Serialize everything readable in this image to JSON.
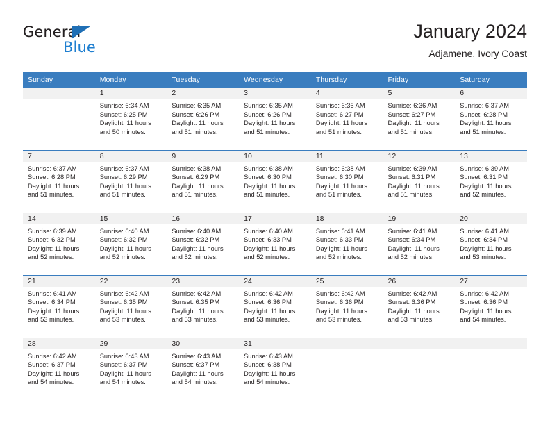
{
  "brand": {
    "name_part1": "General",
    "name_part2": "Blue",
    "triangle_color": "#1f6fb5",
    "blue_color": "#1f7fd0"
  },
  "header": {
    "title": "January 2024",
    "subtitle": "Adjamene, Ivory Coast"
  },
  "theme": {
    "header_bg": "#3a7dbf",
    "daynum_bg": "#f1f1f1",
    "text": "#231f20"
  },
  "weekday_headers": [
    "Sunday",
    "Monday",
    "Tuesday",
    "Wednesday",
    "Thursday",
    "Friday",
    "Saturday"
  ],
  "labels": {
    "sunrise_prefix": "Sunrise:",
    "sunset_prefix": "Sunset:",
    "daylight_prefix": "Daylight:"
  },
  "weeks": [
    [
      {
        "day": "",
        "empty": true
      },
      {
        "day": "1",
        "sunrise": "Sunrise: 6:34 AM",
        "sunset": "Sunset: 6:25 PM",
        "daylight1": "Daylight: 11 hours",
        "daylight2": "and 50 minutes."
      },
      {
        "day": "2",
        "sunrise": "Sunrise: 6:35 AM",
        "sunset": "Sunset: 6:26 PM",
        "daylight1": "Daylight: 11 hours",
        "daylight2": "and 51 minutes."
      },
      {
        "day": "3",
        "sunrise": "Sunrise: 6:35 AM",
        "sunset": "Sunset: 6:26 PM",
        "daylight1": "Daylight: 11 hours",
        "daylight2": "and 51 minutes."
      },
      {
        "day": "4",
        "sunrise": "Sunrise: 6:36 AM",
        "sunset": "Sunset: 6:27 PM",
        "daylight1": "Daylight: 11 hours",
        "daylight2": "and 51 minutes."
      },
      {
        "day": "5",
        "sunrise": "Sunrise: 6:36 AM",
        "sunset": "Sunset: 6:27 PM",
        "daylight1": "Daylight: 11 hours",
        "daylight2": "and 51 minutes."
      },
      {
        "day": "6",
        "sunrise": "Sunrise: 6:37 AM",
        "sunset": "Sunset: 6:28 PM",
        "daylight1": "Daylight: 11 hours",
        "daylight2": "and 51 minutes."
      }
    ],
    [
      {
        "day": "7",
        "sunrise": "Sunrise: 6:37 AM",
        "sunset": "Sunset: 6:28 PM",
        "daylight1": "Daylight: 11 hours",
        "daylight2": "and 51 minutes."
      },
      {
        "day": "8",
        "sunrise": "Sunrise: 6:37 AM",
        "sunset": "Sunset: 6:29 PM",
        "daylight1": "Daylight: 11 hours",
        "daylight2": "and 51 minutes."
      },
      {
        "day": "9",
        "sunrise": "Sunrise: 6:38 AM",
        "sunset": "Sunset: 6:29 PM",
        "daylight1": "Daylight: 11 hours",
        "daylight2": "and 51 minutes."
      },
      {
        "day": "10",
        "sunrise": "Sunrise: 6:38 AM",
        "sunset": "Sunset: 6:30 PM",
        "daylight1": "Daylight: 11 hours",
        "daylight2": "and 51 minutes."
      },
      {
        "day": "11",
        "sunrise": "Sunrise: 6:38 AM",
        "sunset": "Sunset: 6:30 PM",
        "daylight1": "Daylight: 11 hours",
        "daylight2": "and 51 minutes."
      },
      {
        "day": "12",
        "sunrise": "Sunrise: 6:39 AM",
        "sunset": "Sunset: 6:31 PM",
        "daylight1": "Daylight: 11 hours",
        "daylight2": "and 51 minutes."
      },
      {
        "day": "13",
        "sunrise": "Sunrise: 6:39 AM",
        "sunset": "Sunset: 6:31 PM",
        "daylight1": "Daylight: 11 hours",
        "daylight2": "and 52 minutes."
      }
    ],
    [
      {
        "day": "14",
        "sunrise": "Sunrise: 6:39 AM",
        "sunset": "Sunset: 6:32 PM",
        "daylight1": "Daylight: 11 hours",
        "daylight2": "and 52 minutes."
      },
      {
        "day": "15",
        "sunrise": "Sunrise: 6:40 AM",
        "sunset": "Sunset: 6:32 PM",
        "daylight1": "Daylight: 11 hours",
        "daylight2": "and 52 minutes."
      },
      {
        "day": "16",
        "sunrise": "Sunrise: 6:40 AM",
        "sunset": "Sunset: 6:32 PM",
        "daylight1": "Daylight: 11 hours",
        "daylight2": "and 52 minutes."
      },
      {
        "day": "17",
        "sunrise": "Sunrise: 6:40 AM",
        "sunset": "Sunset: 6:33 PM",
        "daylight1": "Daylight: 11 hours",
        "daylight2": "and 52 minutes."
      },
      {
        "day": "18",
        "sunrise": "Sunrise: 6:41 AM",
        "sunset": "Sunset: 6:33 PM",
        "daylight1": "Daylight: 11 hours",
        "daylight2": "and 52 minutes."
      },
      {
        "day": "19",
        "sunrise": "Sunrise: 6:41 AM",
        "sunset": "Sunset: 6:34 PM",
        "daylight1": "Daylight: 11 hours",
        "daylight2": "and 52 minutes."
      },
      {
        "day": "20",
        "sunrise": "Sunrise: 6:41 AM",
        "sunset": "Sunset: 6:34 PM",
        "daylight1": "Daylight: 11 hours",
        "daylight2": "and 53 minutes."
      }
    ],
    [
      {
        "day": "21",
        "sunrise": "Sunrise: 6:41 AM",
        "sunset": "Sunset: 6:34 PM",
        "daylight1": "Daylight: 11 hours",
        "daylight2": "and 53 minutes."
      },
      {
        "day": "22",
        "sunrise": "Sunrise: 6:42 AM",
        "sunset": "Sunset: 6:35 PM",
        "daylight1": "Daylight: 11 hours",
        "daylight2": "and 53 minutes."
      },
      {
        "day": "23",
        "sunrise": "Sunrise: 6:42 AM",
        "sunset": "Sunset: 6:35 PM",
        "daylight1": "Daylight: 11 hours",
        "daylight2": "and 53 minutes."
      },
      {
        "day": "24",
        "sunrise": "Sunrise: 6:42 AM",
        "sunset": "Sunset: 6:36 PM",
        "daylight1": "Daylight: 11 hours",
        "daylight2": "and 53 minutes."
      },
      {
        "day": "25",
        "sunrise": "Sunrise: 6:42 AM",
        "sunset": "Sunset: 6:36 PM",
        "daylight1": "Daylight: 11 hours",
        "daylight2": "and 53 minutes."
      },
      {
        "day": "26",
        "sunrise": "Sunrise: 6:42 AM",
        "sunset": "Sunset: 6:36 PM",
        "daylight1": "Daylight: 11 hours",
        "daylight2": "and 53 minutes."
      },
      {
        "day": "27",
        "sunrise": "Sunrise: 6:42 AM",
        "sunset": "Sunset: 6:36 PM",
        "daylight1": "Daylight: 11 hours",
        "daylight2": "and 54 minutes."
      }
    ],
    [
      {
        "day": "28",
        "sunrise": "Sunrise: 6:42 AM",
        "sunset": "Sunset: 6:37 PM",
        "daylight1": "Daylight: 11 hours",
        "daylight2": "and 54 minutes."
      },
      {
        "day": "29",
        "sunrise": "Sunrise: 6:43 AM",
        "sunset": "Sunset: 6:37 PM",
        "daylight1": "Daylight: 11 hours",
        "daylight2": "and 54 minutes."
      },
      {
        "day": "30",
        "sunrise": "Sunrise: 6:43 AM",
        "sunset": "Sunset: 6:37 PM",
        "daylight1": "Daylight: 11 hours",
        "daylight2": "and 54 minutes."
      },
      {
        "day": "31",
        "sunrise": "Sunrise: 6:43 AM",
        "sunset": "Sunset: 6:38 PM",
        "daylight1": "Daylight: 11 hours",
        "daylight2": "and 54 minutes."
      },
      {
        "day": "",
        "empty": true
      },
      {
        "day": "",
        "empty": true
      },
      {
        "day": "",
        "empty": true
      }
    ]
  ]
}
